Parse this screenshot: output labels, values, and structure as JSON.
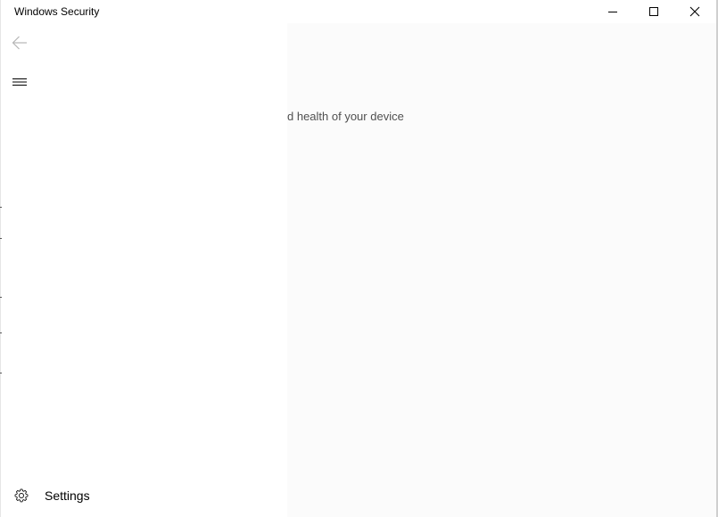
{
  "window": {
    "title": "Windows Security"
  },
  "caption_buttons": {
    "minimize": "minimize-icon",
    "maximize": "maximize-icon",
    "close": "close-icon"
  },
  "nav": {
    "back_icon": "back-arrow-icon",
    "menu_icon": "hamburger-menu-icon",
    "settings": {
      "label": "Settings",
      "icon": "gear-icon"
    }
  },
  "content": {
    "subtitle_fragment": "d health of your device"
  },
  "colors": {
    "content_background": "#fbfbfb",
    "nav_background": "#ffffff",
    "disabled_icon": "#b5b5b5",
    "text_secondary": "#505050"
  }
}
